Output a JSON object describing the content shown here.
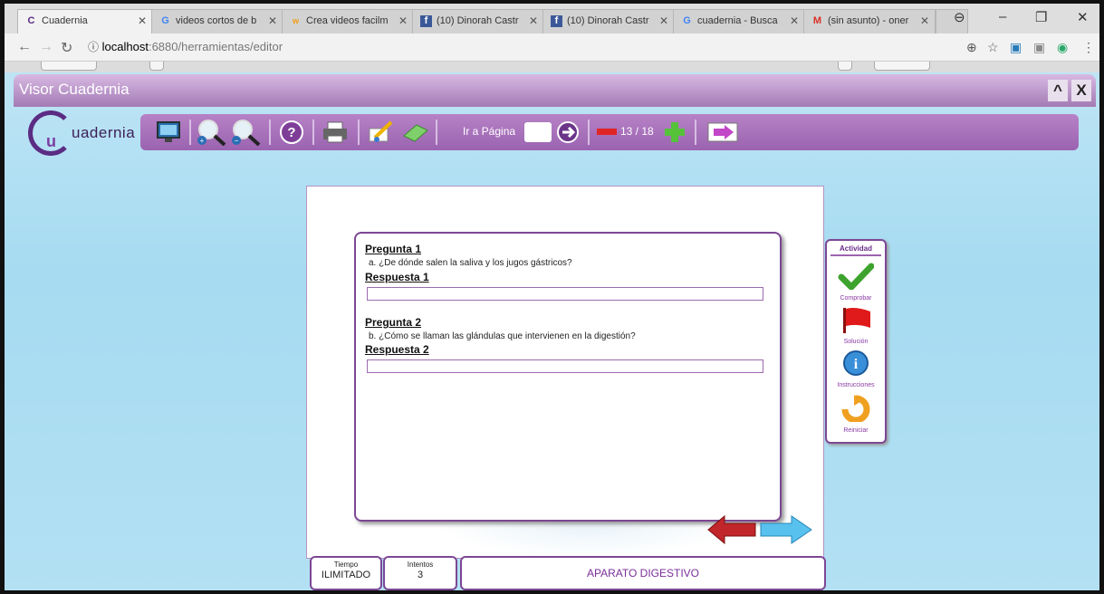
{
  "browser": {
    "tabs": [
      {
        "title": "Cuadernia",
        "icon": "cuadernia-favicon",
        "active": true
      },
      {
        "title": "videos cortos de b",
        "icon": "google-favicon"
      },
      {
        "title": "Crea videos facilm",
        "icon": "wideo-favicon"
      },
      {
        "title": "(10) Dinorah Castr",
        "icon": "facebook-favicon"
      },
      {
        "title": "(10) Dinorah Castr",
        "icon": "facebook-favicon"
      },
      {
        "title": "cuadernia - Busca",
        "icon": "google-favicon"
      },
      {
        "title": "(sin asunto) - oner",
        "icon": "gmail-favicon"
      }
    ],
    "address": {
      "host": "localhost",
      "path": ":6880/herramientas/editor"
    }
  },
  "app": {
    "window_title": "Visor Cuadernia",
    "logo_text": "uadernia",
    "goto_label": "Ir a Página",
    "page_indicator": "13 / 18"
  },
  "activity": {
    "questions": [
      {
        "heading": "Pregunta 1",
        "text": "a. ¿De dónde salen la saliva y los jugos gástricos?",
        "answer_label": "Respuesta 1",
        "answer_value": ""
      },
      {
        "heading": "Pregunta 2",
        "text": "b. ¿Cómo se llaman las glándulas que intervienen en la digestión?",
        "answer_label": "Respuesta 2",
        "answer_value": ""
      }
    ],
    "panel": {
      "title": "Actividad",
      "buttons": [
        "Comprobar",
        "Solución",
        "Instrucciones",
        "Reiniciar"
      ]
    }
  },
  "footer": {
    "time_label": "Tiempo",
    "time_value": "ILIMITADO",
    "attempts_label": "Intentos",
    "attempts_value": "3",
    "subject": "APARATO DIGESTIVO"
  },
  "colors": {
    "accent": "#9b63b0",
    "title_text": "#7a2e9a",
    "next_arrow": "#58c1ee",
    "prev_arrow": "#c0262a"
  }
}
